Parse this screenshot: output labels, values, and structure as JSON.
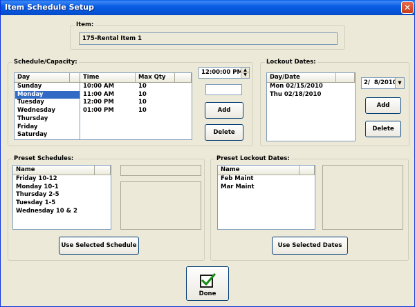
{
  "window": {
    "title": "Item Schedule Setup",
    "close_symbol": "✕"
  },
  "item": {
    "label": "Item:",
    "value": "175-Rental Item 1"
  },
  "schedule": {
    "label": "Schedule/Capacity:",
    "day_header": "Day",
    "days": [
      "Sunday",
      "Monday",
      "Tuesday",
      "Wednesday",
      "Thursday",
      "Friday",
      "Saturday"
    ],
    "selected_day": "Monday",
    "time_header": "Time",
    "qty_header": "Max Qty",
    "rows": [
      {
        "time": "10:00 AM",
        "qty": "10"
      },
      {
        "time": "11:00 AM",
        "qty": "10"
      },
      {
        "time": "12:00 PM",
        "qty": "10"
      },
      {
        "time": "01:00 PM",
        "qty": "10"
      }
    ],
    "time_input": "12:00:00 PM",
    "qty_input": "",
    "add_label": "Add",
    "delete_label": "Delete"
  },
  "lockout": {
    "label": "Lockout Dates:",
    "header": "Day/Date",
    "dates": [
      "Mon 02/15/2010",
      "Thu 02/18/2010"
    ],
    "date_picker": "2/  8/2010",
    "add_label": "Add",
    "delete_label": "Delete"
  },
  "preset_schedules": {
    "label": "Preset Schedules:",
    "header": "Name",
    "items": [
      "Friday 10-12",
      "Monday 10-1",
      "Thursday 2-5",
      "Tuesday 1-5",
      "Wednesday 10 & 2"
    ],
    "use_label": "Use Selected Schedule"
  },
  "preset_lockout": {
    "label": "Preset Lockout Dates:",
    "header": "Name",
    "items": [
      "Feb Maint",
      "Mar Maint"
    ],
    "use_label": "Use Selected Dates"
  },
  "done_label": "Done",
  "colors": {
    "titlebar": "#0553d8",
    "selection": "#316ac5",
    "checkmark": "#1a8f1a"
  }
}
